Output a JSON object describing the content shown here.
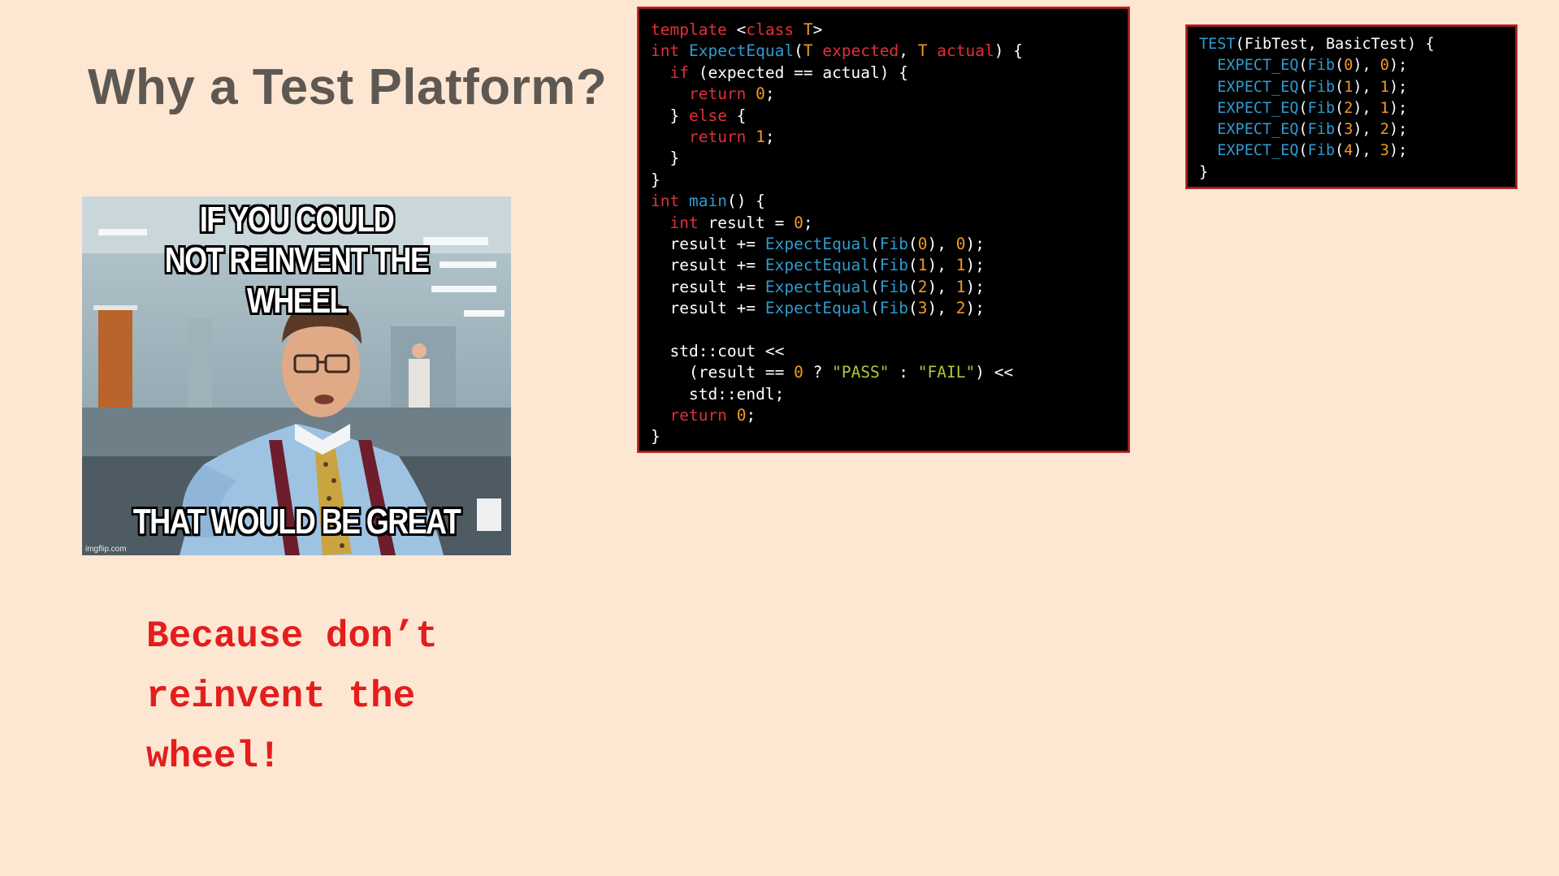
{
  "slide": {
    "title": "Why a Test Platform?",
    "tagline_lines": [
      "Because don’t",
      "reinvent the",
      "wheel!"
    ]
  },
  "meme": {
    "top_caption_lines": [
      "IF YOU COULD",
      "NOT REINVENT THE WHEEL"
    ],
    "bottom_caption": "THAT WOULD BE GREAT",
    "watermark": "imgflip.com"
  },
  "code_manual": {
    "lines": [
      [
        [
          "kw",
          "template"
        ],
        [
          "plain",
          " <"
        ],
        [
          "kw",
          "class"
        ],
        [
          "plain",
          " "
        ],
        [
          "typ",
          "T"
        ],
        [
          "plain",
          ">"
        ]
      ],
      [
        [
          "kw",
          "int"
        ],
        [
          "plain",
          " "
        ],
        [
          "fn",
          "ExpectEqual"
        ],
        [
          "plain",
          "("
        ],
        [
          "typ",
          "T"
        ],
        [
          "plain",
          " "
        ],
        [
          "kw",
          "expected"
        ],
        [
          "plain",
          ", "
        ],
        [
          "typ",
          "T"
        ],
        [
          "plain",
          " "
        ],
        [
          "kw",
          "actual"
        ],
        [
          "plain",
          ") {"
        ]
      ],
      [
        [
          "plain",
          "  "
        ],
        [
          "kw",
          "if"
        ],
        [
          "plain",
          " (expected == actual) {"
        ]
      ],
      [
        [
          "plain",
          "    "
        ],
        [
          "kw",
          "return"
        ],
        [
          "plain",
          " "
        ],
        [
          "num",
          "0"
        ],
        [
          "plain",
          ";"
        ]
      ],
      [
        [
          "plain",
          "  } "
        ],
        [
          "kw",
          "else"
        ],
        [
          "plain",
          " {"
        ]
      ],
      [
        [
          "plain",
          "    "
        ],
        [
          "kw",
          "return"
        ],
        [
          "plain",
          " "
        ],
        [
          "num",
          "1"
        ],
        [
          "plain",
          ";"
        ]
      ],
      [
        [
          "plain",
          "  }"
        ]
      ],
      [
        [
          "plain",
          "}"
        ]
      ],
      [
        [
          "kw",
          "int"
        ],
        [
          "plain",
          " "
        ],
        [
          "fn",
          "main"
        ],
        [
          "plain",
          "() {"
        ]
      ],
      [
        [
          "plain",
          "  "
        ],
        [
          "kw",
          "int"
        ],
        [
          "plain",
          " result = "
        ],
        [
          "num",
          "0"
        ],
        [
          "plain",
          ";"
        ]
      ],
      [
        [
          "plain",
          "  result += "
        ],
        [
          "fn",
          "ExpectEqual"
        ],
        [
          "plain",
          "("
        ],
        [
          "fn",
          "Fib"
        ],
        [
          "plain",
          "("
        ],
        [
          "num",
          "0"
        ],
        [
          "plain",
          "), "
        ],
        [
          "num",
          "0"
        ],
        [
          "plain",
          ");"
        ]
      ],
      [
        [
          "plain",
          "  result += "
        ],
        [
          "fn",
          "ExpectEqual"
        ],
        [
          "plain",
          "("
        ],
        [
          "fn",
          "Fib"
        ],
        [
          "plain",
          "("
        ],
        [
          "num",
          "1"
        ],
        [
          "plain",
          "), "
        ],
        [
          "num",
          "1"
        ],
        [
          "plain",
          ");"
        ]
      ],
      [
        [
          "plain",
          "  result += "
        ],
        [
          "fn",
          "ExpectEqual"
        ],
        [
          "plain",
          "("
        ],
        [
          "fn",
          "Fib"
        ],
        [
          "plain",
          "("
        ],
        [
          "num",
          "2"
        ],
        [
          "plain",
          "), "
        ],
        [
          "num",
          "1"
        ],
        [
          "plain",
          ");"
        ]
      ],
      [
        [
          "plain",
          "  result += "
        ],
        [
          "fn",
          "ExpectEqual"
        ],
        [
          "plain",
          "("
        ],
        [
          "fn",
          "Fib"
        ],
        [
          "plain",
          "("
        ],
        [
          "num",
          "3"
        ],
        [
          "plain",
          "), "
        ],
        [
          "num",
          "2"
        ],
        [
          "plain",
          ");"
        ]
      ],
      [
        [
          "plain",
          ""
        ]
      ],
      [
        [
          "plain",
          "  std::cout <<"
        ]
      ],
      [
        [
          "plain",
          "    (result == "
        ],
        [
          "num",
          "0"
        ],
        [
          "plain",
          " ? "
        ],
        [
          "str",
          "\"PASS\""
        ],
        [
          "plain",
          " : "
        ],
        [
          "str",
          "\"FAIL\""
        ],
        [
          "plain",
          ") <<"
        ]
      ],
      [
        [
          "plain",
          "    std::endl;"
        ]
      ],
      [
        [
          "plain",
          "  "
        ],
        [
          "kw",
          "return"
        ],
        [
          "plain",
          " "
        ],
        [
          "num",
          "0"
        ],
        [
          "plain",
          ";"
        ]
      ],
      [
        [
          "plain",
          "}"
        ]
      ]
    ]
  },
  "code_gtest": {
    "lines": [
      [
        [
          "fn",
          "TEST"
        ],
        [
          "plain",
          "(FibTest, BasicTest) {"
        ]
      ],
      [
        [
          "plain",
          "  "
        ],
        [
          "fn",
          "EXPECT_EQ"
        ],
        [
          "plain",
          "("
        ],
        [
          "fn",
          "Fib"
        ],
        [
          "plain",
          "("
        ],
        [
          "num",
          "0"
        ],
        [
          "plain",
          "), "
        ],
        [
          "num",
          "0"
        ],
        [
          "plain",
          ");"
        ]
      ],
      [
        [
          "plain",
          "  "
        ],
        [
          "fn",
          "EXPECT_EQ"
        ],
        [
          "plain",
          "("
        ],
        [
          "fn",
          "Fib"
        ],
        [
          "plain",
          "("
        ],
        [
          "num",
          "1"
        ],
        [
          "plain",
          "), "
        ],
        [
          "num",
          "1"
        ],
        [
          "plain",
          ");"
        ]
      ],
      [
        [
          "plain",
          "  "
        ],
        [
          "fn",
          "EXPECT_EQ"
        ],
        [
          "plain",
          "("
        ],
        [
          "fn",
          "Fib"
        ],
        [
          "plain",
          "("
        ],
        [
          "num",
          "2"
        ],
        [
          "plain",
          "), "
        ],
        [
          "num",
          "1"
        ],
        [
          "plain",
          ");"
        ]
      ],
      [
        [
          "plain",
          "  "
        ],
        [
          "fn",
          "EXPECT_EQ"
        ],
        [
          "plain",
          "("
        ],
        [
          "fn",
          "Fib"
        ],
        [
          "plain",
          "("
        ],
        [
          "num",
          "3"
        ],
        [
          "plain",
          "), "
        ],
        [
          "num",
          "2"
        ],
        [
          "plain",
          ");"
        ]
      ],
      [
        [
          "plain",
          "  "
        ],
        [
          "fn",
          "EXPECT_EQ"
        ],
        [
          "plain",
          "("
        ],
        [
          "fn",
          "Fib"
        ],
        [
          "plain",
          "("
        ],
        [
          "num",
          "4"
        ],
        [
          "plain",
          "), "
        ],
        [
          "num",
          "3"
        ],
        [
          "plain",
          ");"
        ]
      ],
      [
        [
          "plain",
          "}"
        ]
      ]
    ]
  },
  "colors": {
    "background": "#fde7d3",
    "title": "#5e5852",
    "tagline": "#e41d1d",
    "keyword": "#e0303a",
    "function": "#2f9bd0",
    "number": "#f39a1e",
    "string": "#a9c93b"
  }
}
